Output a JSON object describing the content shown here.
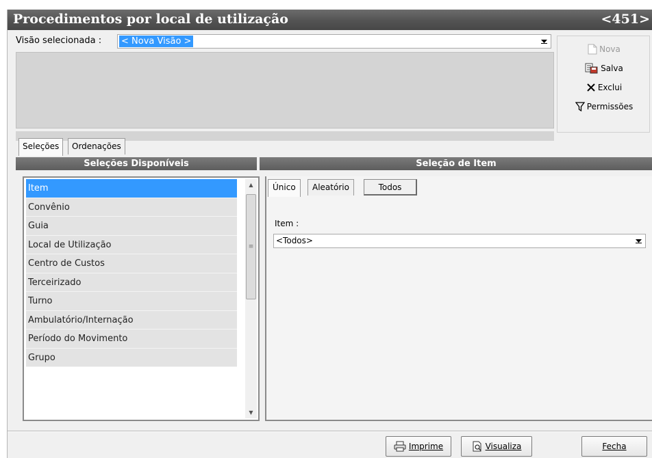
{
  "window": {
    "title": "Procedimentos por local de utilização",
    "code": "<451>"
  },
  "view": {
    "label": "Visão selecionada  :",
    "selected": "< Nova Visão >"
  },
  "actions": {
    "nova": "Nova",
    "salva": "Salva",
    "exclui": "Exclui",
    "permissoes": "Permissões"
  },
  "tabs": {
    "selecoes": "Seleções",
    "ordenacoes": "Ordenações"
  },
  "left_panel": {
    "header": "Seleções Disponíveis",
    "items": [
      "Item",
      "Convênio",
      "Guia",
      "Local de Utilização",
      "Centro de Custos",
      "Terceirizado",
      "Turno",
      "Ambulatório/Internação",
      "Período do Movimento",
      "Grupo"
    ]
  },
  "right_panel": {
    "header": "Seleção de Item",
    "tabs": {
      "unico": "Único",
      "aleatorio": "Aleatório",
      "todos": "Todos"
    },
    "item_label": "Item :",
    "item_value": "<Todos>"
  },
  "footer": {
    "imprime": "Imprime",
    "visualiza": "Visualiza",
    "fecha": "Fecha"
  },
  "colors": {
    "title_bar": "#555555",
    "selection": "#3399ff",
    "panel_header": "#6a6a6a"
  }
}
